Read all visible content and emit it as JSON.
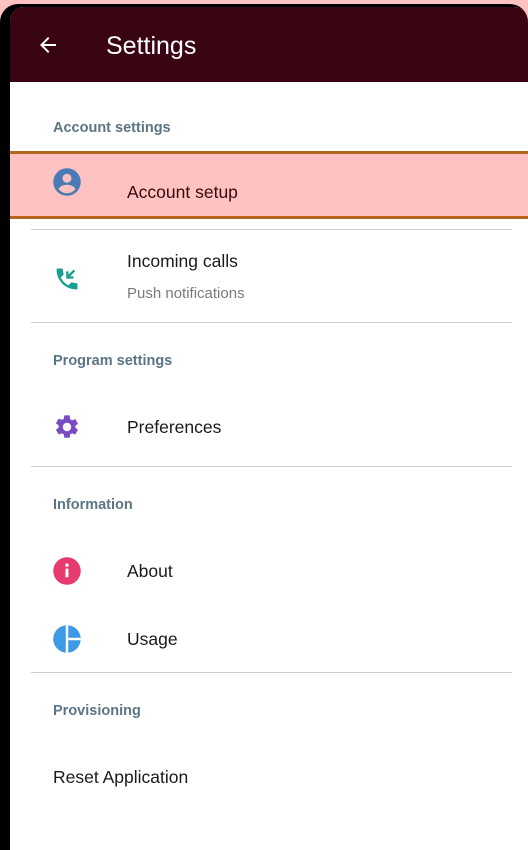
{
  "appbar": {
    "title": "Settings",
    "back_icon": "arrow-left-icon"
  },
  "sections": {
    "account": {
      "header": "Account settings",
      "account_setup": {
        "label": "Account setup",
        "icon": "account-circle-icon",
        "icon_color": "#4a7bb4",
        "highlighted": true
      },
      "incoming_calls": {
        "label": "Incoming calls",
        "sublabel": "Push notifications",
        "icon": "phone-incoming-icon",
        "icon_color": "#1a9e8f"
      }
    },
    "program": {
      "header": "Program settings",
      "preferences": {
        "label": "Preferences",
        "icon": "gear-icon",
        "icon_color": "#7a4cc4"
      }
    },
    "information": {
      "header": "Information",
      "about": {
        "label": "About",
        "icon": "info-icon",
        "icon_color": "#e63a70"
      },
      "usage": {
        "label": "Usage",
        "icon": "pie-chart-icon",
        "icon_color": "#3e9ae6"
      }
    },
    "provisioning": {
      "header": "Provisioning",
      "reset": {
        "label": "Reset Application"
      }
    }
  },
  "colors": {
    "appbar": "#3a0513",
    "highlight_fill": "#ffc2c2",
    "highlight_border": "#b5651d",
    "section_header": "#5a7585"
  }
}
